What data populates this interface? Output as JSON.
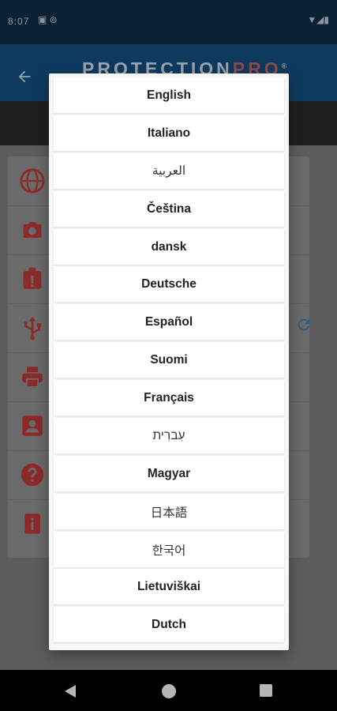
{
  "status_bar": {
    "time": "8:07"
  },
  "app_bar": {
    "brand_part1": "PROTECTION",
    "brand_part2": "PRO",
    "brand_mark": "®"
  },
  "colors": {
    "accent_red": "#d32f2f",
    "refresh_blue": "#2f6fb0"
  },
  "menu_icons": [
    "globe-icon",
    "camera-icon",
    "warning-icon",
    "usb-icon",
    "printer-icon",
    "contact-icon",
    "help-icon",
    "info-icon"
  ],
  "language_dialog": {
    "options": [
      {
        "label": "English"
      },
      {
        "label": "Italiano"
      },
      {
        "label": "العربية"
      },
      {
        "label": "Čeština"
      },
      {
        "label": "dansk"
      },
      {
        "label": "Deutsche"
      },
      {
        "label": "Español"
      },
      {
        "label": "Suomi"
      },
      {
        "label": "Français"
      },
      {
        "label": "עִברִית"
      },
      {
        "label": "Magyar"
      },
      {
        "label": "日本語"
      },
      {
        "label": "한국어"
      },
      {
        "label": "Lietuviškai"
      },
      {
        "label": "Dutch"
      }
    ]
  }
}
